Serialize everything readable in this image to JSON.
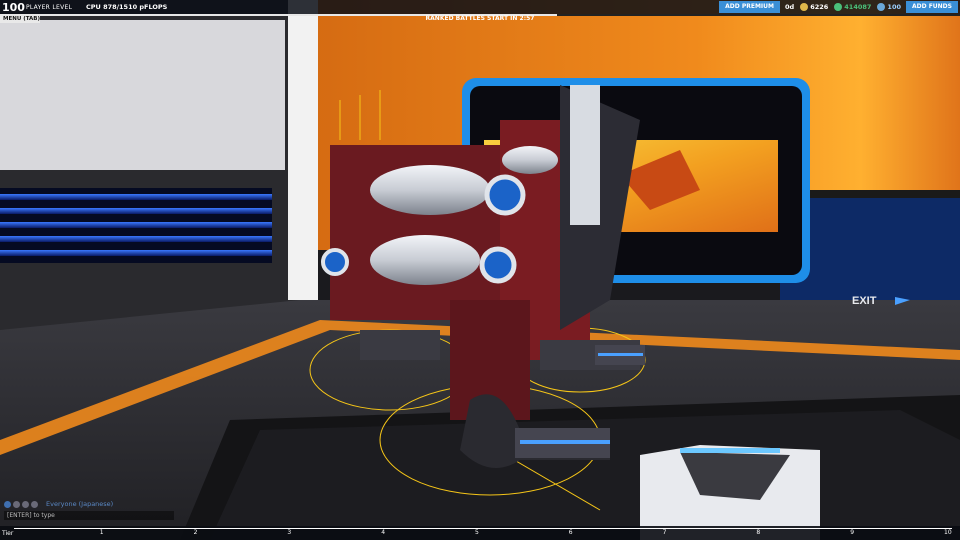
{
  "hud": {
    "player_level": "100",
    "player_level_label": "PLAYER LEVEL",
    "cpu_text": "CPU 878/1510 pFLOPS",
    "cpu_fraction": 0.58,
    "menu_label": "MENU (TAB)",
    "ranked_text": "RANKED BATTLES START IN  2:57",
    "add_premium": "ADD PREMIUM",
    "premium_days": "0d",
    "currency_1": "6226",
    "currency_2": "414087",
    "currency_3": "100",
    "add_funds": "ADD FUNDS"
  },
  "scene": {
    "exit_label": "EXIT"
  },
  "chat": {
    "channel": "Everyone (Japanese)",
    "input_placeholder": "[ENTER] to type"
  },
  "tier_bar": {
    "label": "Tier",
    "ticks": [
      "1",
      "2",
      "3",
      "4",
      "5",
      "6",
      "7",
      "8",
      "9",
      "10"
    ]
  },
  "colors": {
    "accent_blue": "#3a8fd6",
    "accent_orange": "#f08a1c",
    "hologram_yellow": "#f5c518",
    "robot_red": "#7a1c22"
  }
}
